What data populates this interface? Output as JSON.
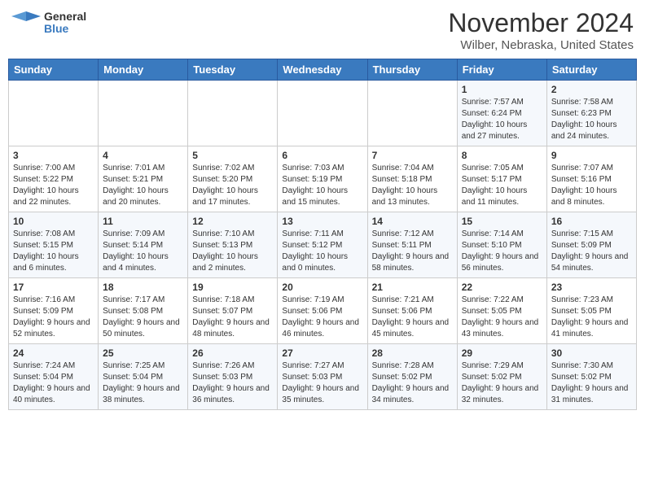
{
  "header": {
    "logo_general": "General",
    "logo_blue": "Blue",
    "month_title": "November 2024",
    "location": "Wilber, Nebraska, United States"
  },
  "weekdays": [
    "Sunday",
    "Monday",
    "Tuesday",
    "Wednesday",
    "Thursday",
    "Friday",
    "Saturday"
  ],
  "weeks": [
    [
      {
        "day": "",
        "info": ""
      },
      {
        "day": "",
        "info": ""
      },
      {
        "day": "",
        "info": ""
      },
      {
        "day": "",
        "info": ""
      },
      {
        "day": "",
        "info": ""
      },
      {
        "day": "1",
        "info": "Sunrise: 7:57 AM\nSunset: 6:24 PM\nDaylight: 10 hours and 27 minutes."
      },
      {
        "day": "2",
        "info": "Sunrise: 7:58 AM\nSunset: 6:23 PM\nDaylight: 10 hours and 24 minutes."
      }
    ],
    [
      {
        "day": "3",
        "info": "Sunrise: 7:00 AM\nSunset: 5:22 PM\nDaylight: 10 hours and 22 minutes."
      },
      {
        "day": "4",
        "info": "Sunrise: 7:01 AM\nSunset: 5:21 PM\nDaylight: 10 hours and 20 minutes."
      },
      {
        "day": "5",
        "info": "Sunrise: 7:02 AM\nSunset: 5:20 PM\nDaylight: 10 hours and 17 minutes."
      },
      {
        "day": "6",
        "info": "Sunrise: 7:03 AM\nSunset: 5:19 PM\nDaylight: 10 hours and 15 minutes."
      },
      {
        "day": "7",
        "info": "Sunrise: 7:04 AM\nSunset: 5:18 PM\nDaylight: 10 hours and 13 minutes."
      },
      {
        "day": "8",
        "info": "Sunrise: 7:05 AM\nSunset: 5:17 PM\nDaylight: 10 hours and 11 minutes."
      },
      {
        "day": "9",
        "info": "Sunrise: 7:07 AM\nSunset: 5:16 PM\nDaylight: 10 hours and 8 minutes."
      }
    ],
    [
      {
        "day": "10",
        "info": "Sunrise: 7:08 AM\nSunset: 5:15 PM\nDaylight: 10 hours and 6 minutes."
      },
      {
        "day": "11",
        "info": "Sunrise: 7:09 AM\nSunset: 5:14 PM\nDaylight: 10 hours and 4 minutes."
      },
      {
        "day": "12",
        "info": "Sunrise: 7:10 AM\nSunset: 5:13 PM\nDaylight: 10 hours and 2 minutes."
      },
      {
        "day": "13",
        "info": "Sunrise: 7:11 AM\nSunset: 5:12 PM\nDaylight: 10 hours and 0 minutes."
      },
      {
        "day": "14",
        "info": "Sunrise: 7:12 AM\nSunset: 5:11 PM\nDaylight: 9 hours and 58 minutes."
      },
      {
        "day": "15",
        "info": "Sunrise: 7:14 AM\nSunset: 5:10 PM\nDaylight: 9 hours and 56 minutes."
      },
      {
        "day": "16",
        "info": "Sunrise: 7:15 AM\nSunset: 5:09 PM\nDaylight: 9 hours and 54 minutes."
      }
    ],
    [
      {
        "day": "17",
        "info": "Sunrise: 7:16 AM\nSunset: 5:09 PM\nDaylight: 9 hours and 52 minutes."
      },
      {
        "day": "18",
        "info": "Sunrise: 7:17 AM\nSunset: 5:08 PM\nDaylight: 9 hours and 50 minutes."
      },
      {
        "day": "19",
        "info": "Sunrise: 7:18 AM\nSunset: 5:07 PM\nDaylight: 9 hours and 48 minutes."
      },
      {
        "day": "20",
        "info": "Sunrise: 7:19 AM\nSunset: 5:06 PM\nDaylight: 9 hours and 46 minutes."
      },
      {
        "day": "21",
        "info": "Sunrise: 7:21 AM\nSunset: 5:06 PM\nDaylight: 9 hours and 45 minutes."
      },
      {
        "day": "22",
        "info": "Sunrise: 7:22 AM\nSunset: 5:05 PM\nDaylight: 9 hours and 43 minutes."
      },
      {
        "day": "23",
        "info": "Sunrise: 7:23 AM\nSunset: 5:05 PM\nDaylight: 9 hours and 41 minutes."
      }
    ],
    [
      {
        "day": "24",
        "info": "Sunrise: 7:24 AM\nSunset: 5:04 PM\nDaylight: 9 hours and 40 minutes."
      },
      {
        "day": "25",
        "info": "Sunrise: 7:25 AM\nSunset: 5:04 PM\nDaylight: 9 hours and 38 minutes."
      },
      {
        "day": "26",
        "info": "Sunrise: 7:26 AM\nSunset: 5:03 PM\nDaylight: 9 hours and 36 minutes."
      },
      {
        "day": "27",
        "info": "Sunrise: 7:27 AM\nSunset: 5:03 PM\nDaylight: 9 hours and 35 minutes."
      },
      {
        "day": "28",
        "info": "Sunrise: 7:28 AM\nSunset: 5:02 PM\nDaylight: 9 hours and 34 minutes."
      },
      {
        "day": "29",
        "info": "Sunrise: 7:29 AM\nSunset: 5:02 PM\nDaylight: 9 hours and 32 minutes."
      },
      {
        "day": "30",
        "info": "Sunrise: 7:30 AM\nSunset: 5:02 PM\nDaylight: 9 hours and 31 minutes."
      }
    ]
  ]
}
